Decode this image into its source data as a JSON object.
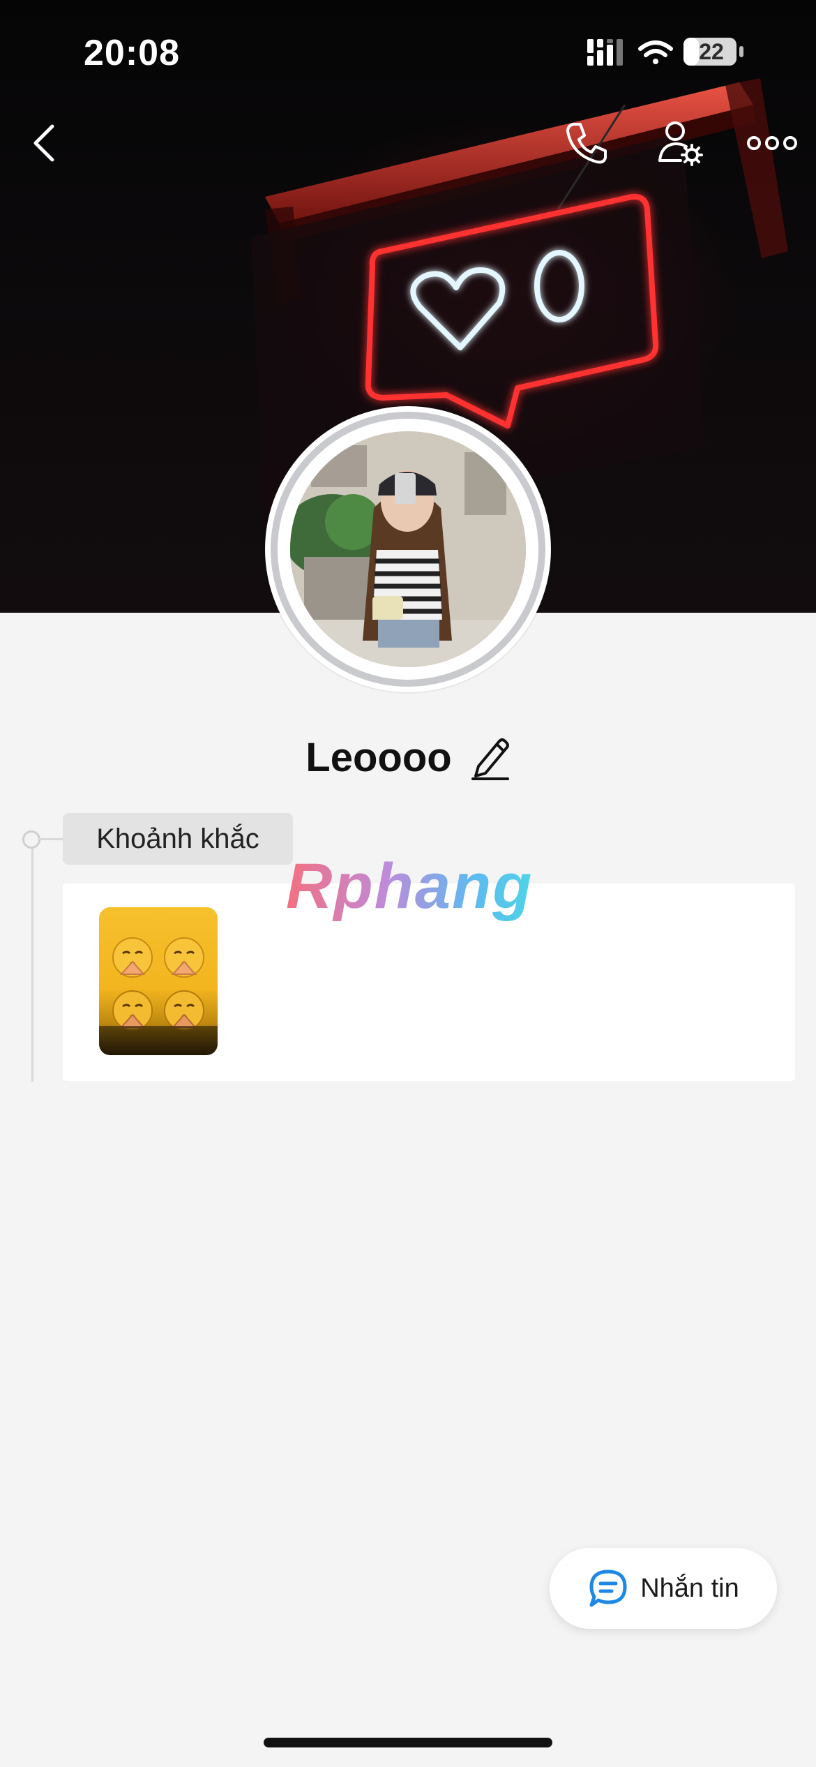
{
  "status_bar": {
    "time": "20:08",
    "battery_level": "22",
    "signal_icon": "cellular-signal-icon",
    "wifi_icon": "wifi-icon",
    "battery_icon": "battery-icon"
  },
  "nav": {
    "back_icon": "chevron-left-icon",
    "call_icon": "phone-icon",
    "profile_settings_icon": "user-gear-icon",
    "more_icon": "more-dots-icon"
  },
  "profile": {
    "name": "Leoooo",
    "edit_icon": "pencil-icon"
  },
  "timeline": {
    "section_label": "Khoảnh khắc"
  },
  "watermark": {
    "text": "Rphang"
  },
  "actions": {
    "message_label": "Nhắn tin",
    "message_icon": "chat-bubble-icon"
  },
  "colors": {
    "background": "#f4f4f4",
    "card": "#ffffff",
    "accent_blue": "#1e88e5",
    "neon_red": "#ff2a2a",
    "neon_blue": "#d8f2ff"
  }
}
